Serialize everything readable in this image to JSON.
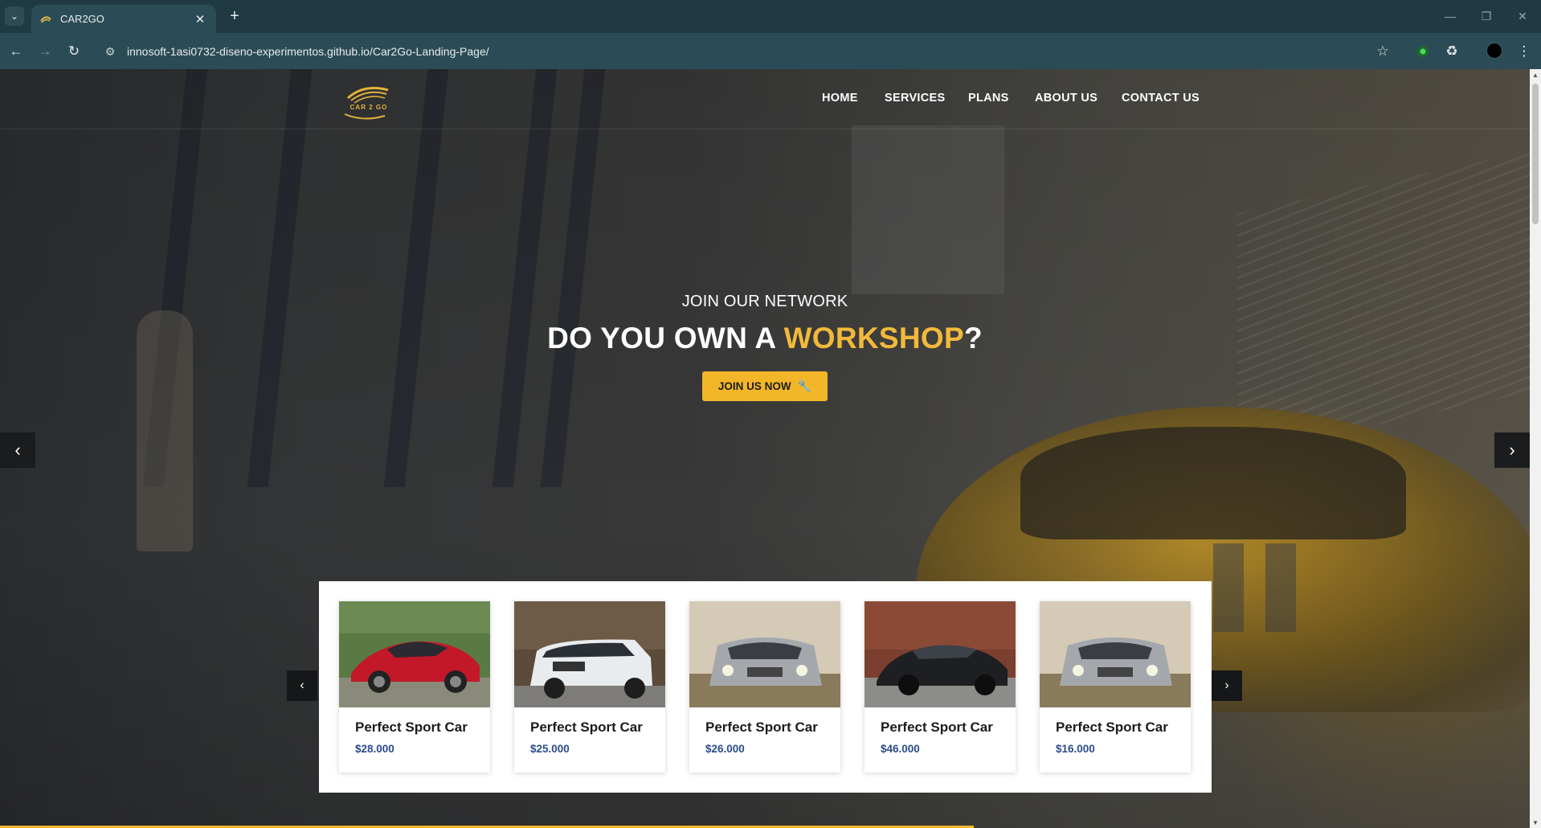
{
  "browser": {
    "tab_title": "CAR2GO",
    "url_host": "innosoft-1asi0732-diseno-experimentos.github.io",
    "url_path": "/Car2Go-Landing-Page/"
  },
  "site": {
    "logo_text": "CAR 2 GO",
    "nav": [
      {
        "label": "HOME"
      },
      {
        "label": "SERVICES"
      },
      {
        "label": "PLANS"
      },
      {
        "label": "ABOUT US"
      },
      {
        "label": "CONTACT US"
      }
    ]
  },
  "hero": {
    "kicker": "JOIN OUR NETWORK",
    "headline_pre": "DO YOU OWN A ",
    "headline_accent": "WORKSHOP",
    "headline_post": "?",
    "cta_label": "JOIN US NOW",
    "cta_icon": "wrench-icon",
    "prev_icon": "chevron-left-icon",
    "next_icon": "chevron-right-icon"
  },
  "cars": [
    {
      "name": "Perfect Sport Car",
      "price": "$28.000",
      "image": "red-sports-car"
    },
    {
      "name": "Perfect Sport Car",
      "price": "$25.000",
      "image": "white-suv"
    },
    {
      "name": "Perfect Sport Car",
      "price": "$26.000",
      "image": "silver-suv"
    },
    {
      "name": "Perfect Sport Car",
      "price": "$46.000",
      "image": "black-sedan"
    },
    {
      "name": "Perfect Sport Car",
      "price": "$16.000",
      "image": "silver-suv"
    }
  ],
  "colors": {
    "accent": "#f2b628",
    "price": "#2a4c8c",
    "chrome": "#2b4c56"
  }
}
